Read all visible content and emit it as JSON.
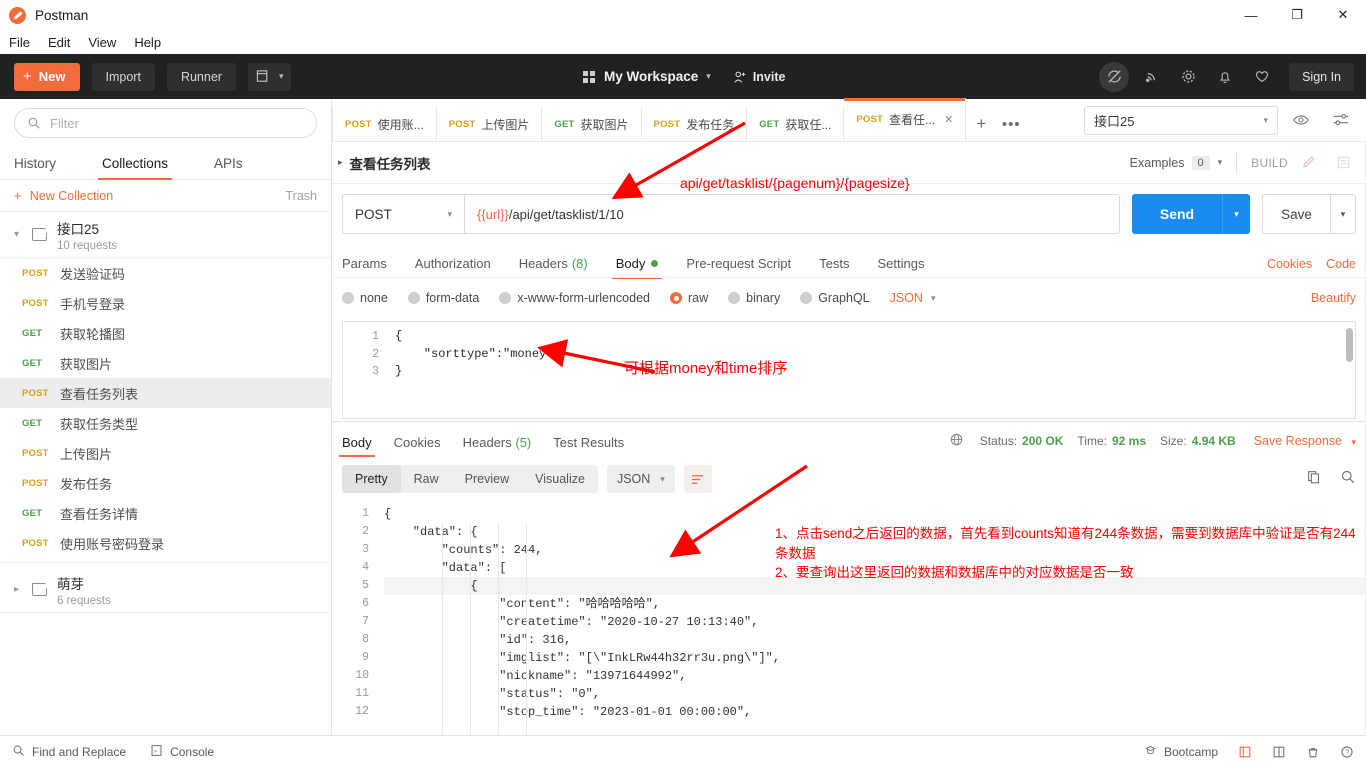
{
  "window": {
    "app_title": "Postman",
    "minimize": "—",
    "maximize": "❐",
    "close": "✕"
  },
  "menubar": {
    "items": [
      "File",
      "Edit",
      "View",
      "Help"
    ]
  },
  "header": {
    "new_label": "New",
    "new_plus": "+",
    "import_label": "Import",
    "runner_label": "Runner",
    "workspace_label": "My Workspace",
    "invite_label": "Invite",
    "signin_label": "Sign In",
    "icons": [
      "sync-off-icon",
      "satellite-icon",
      "gear-icon",
      "bell-icon",
      "heart-icon"
    ],
    "accent": "#f26b3a",
    "background": "#212121"
  },
  "sidebar": {
    "filter_placeholder": "Filter",
    "tabs": [
      {
        "label": "History",
        "active": false
      },
      {
        "label": "Collections",
        "active": true
      },
      {
        "label": "APIs",
        "active": false
      }
    ],
    "new_collection": "New Collection",
    "new_collection_plus": "+",
    "trash": "Trash",
    "collections": [
      {
        "name": "接口25",
        "requests_count": "10 requests",
        "expanded": true,
        "requests": [
          {
            "method": "POST",
            "name": "发送验证码",
            "selected": false
          },
          {
            "method": "POST",
            "name": "手机号登录",
            "selected": false
          },
          {
            "method": "GET",
            "name": "获取轮播图",
            "selected": false
          },
          {
            "method": "GET",
            "name": "获取图片",
            "selected": false
          },
          {
            "method": "POST",
            "name": "查看任务列表",
            "selected": true
          },
          {
            "method": "GET",
            "name": "获取任务类型",
            "selected": false
          },
          {
            "method": "POST",
            "name": "上传图片",
            "selected": false
          },
          {
            "method": "POST",
            "name": "发布任务",
            "selected": false
          },
          {
            "method": "GET",
            "name": "查看任务详情",
            "selected": false
          },
          {
            "method": "POST",
            "name": "使用账号密码登录",
            "selected": false
          }
        ]
      },
      {
        "name": "萌芽",
        "requests_count": "6 requests",
        "expanded": false,
        "requests": []
      }
    ]
  },
  "main": {
    "tabs": [
      {
        "method": "POST",
        "label": "使用账...",
        "active": false
      },
      {
        "method": "POST",
        "label": "上传图片",
        "active": false
      },
      {
        "method": "GET",
        "label": "获取图片",
        "active": false
      },
      {
        "method": "POST",
        "label": "发布任务",
        "active": false
      },
      {
        "method": "GET",
        "label": "获取任...",
        "active": false
      },
      {
        "method": "POST",
        "label": "查看任...",
        "active": true
      }
    ],
    "tab_add": "+",
    "tab_more": "•••",
    "environment": {
      "selected": "接口25",
      "eye_icon": "eye-icon",
      "settings_icon": "sliders-icon"
    },
    "request_title": "查看任务列表",
    "examples_label": "Examples",
    "examples_count": "0",
    "build_label": "BUILD",
    "method": "POST",
    "url_variable": "{{url}}",
    "url_path": "/api/get/tasklist/1/10",
    "send_label": "Send",
    "save_label": "Save",
    "request_tabs": [
      {
        "label": "Params",
        "active": false,
        "count": ""
      },
      {
        "label": "Authorization",
        "active": false,
        "count": ""
      },
      {
        "label": "Headers",
        "active": false,
        "count": "(8)"
      },
      {
        "label": "Body",
        "active": true,
        "count": ""
      },
      {
        "label": "Pre-request Script",
        "active": false,
        "count": ""
      },
      {
        "label": "Tests",
        "active": false,
        "count": ""
      },
      {
        "label": "Settings",
        "active": false,
        "count": ""
      }
    ],
    "cookies_link": "Cookies",
    "code_link": "Code",
    "body_types": [
      {
        "label": "none",
        "selected": false
      },
      {
        "label": "form-data",
        "selected": false
      },
      {
        "label": "x-www-form-urlencoded",
        "selected": false
      },
      {
        "label": "raw",
        "selected": true
      },
      {
        "label": "binary",
        "selected": false
      },
      {
        "label": "GraphQL",
        "selected": false
      }
    ],
    "body_format": "JSON",
    "beautify_label": "Beautify",
    "request_body_lines": [
      {
        "n": "1",
        "text": "{"
      },
      {
        "n": "2",
        "text": "    \"sorttype\":\"money\""
      },
      {
        "n": "3",
        "text": "}"
      }
    ]
  },
  "response": {
    "tabs": [
      {
        "label": "Body",
        "active": true,
        "count": ""
      },
      {
        "label": "Cookies",
        "active": false,
        "count": ""
      },
      {
        "label": "Headers",
        "active": false,
        "count": "(5)"
      },
      {
        "label": "Test Results",
        "active": false,
        "count": ""
      }
    ],
    "status_label": "Status:",
    "status_value": "200 OK",
    "time_label": "Time:",
    "time_value": "92 ms",
    "size_label": "Size:",
    "size_value": "4.94 KB",
    "save_response": "Save Response",
    "view_modes": [
      {
        "label": "Pretty",
        "active": true
      },
      {
        "label": "Raw",
        "active": false
      },
      {
        "label": "Preview",
        "active": false
      },
      {
        "label": "Visualize",
        "active": false
      }
    ],
    "format": "JSON",
    "body_lines": [
      {
        "n": "1",
        "text": "{"
      },
      {
        "n": "2",
        "text": "    \"data\": {"
      },
      {
        "n": "3",
        "text": "        \"counts\": 244,"
      },
      {
        "n": "4",
        "text": "        \"data\": ["
      },
      {
        "n": "5",
        "text": "            {",
        "highlight": true
      },
      {
        "n": "6",
        "text": "                \"content\": \"哈哈哈哈哈\","
      },
      {
        "n": "7",
        "text": "                \"createtime\": \"2020-10-27 10:13:40\","
      },
      {
        "n": "8",
        "text": "                \"id\": 316,"
      },
      {
        "n": "9",
        "text": "                \"imglist\": \"[\\\"InkLRw44h32rr3u.png\\\"]\","
      },
      {
        "n": "10",
        "text": "                \"nickname\": \"13971644992\","
      },
      {
        "n": "11",
        "text": "                \"status\": \"0\","
      },
      {
        "n": "12",
        "text": "                \"stop_time\": \"2023-01-01 00:00:00\","
      }
    ]
  },
  "annotations": {
    "url_note": "api/get/tasklist/{pagenum}/{pagesize}",
    "body_note": "可根据money和time排序",
    "response_note": "1、点击send之后返回的数据，首先看到counts知道有244条数据，需要到数据库中验证是否有244条数据\n2、要查询出这里返回的数据和数据库中的对应数据是否一致",
    "color": "#ff0000"
  },
  "bottombar": {
    "find_replace": "Find and Replace",
    "console": "Console",
    "bootcamp": "Bootcamp",
    "right_icons": [
      "layout-sidebar-icon",
      "layout-split-icon",
      "trash-icon",
      "help-icon"
    ]
  }
}
